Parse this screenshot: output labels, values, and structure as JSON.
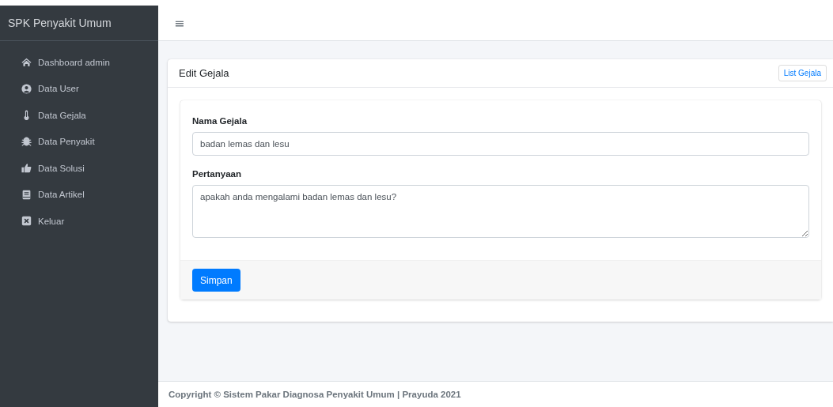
{
  "sidebar": {
    "brand": "SPK Penyakit Umum",
    "items": [
      {
        "label": "Dashboard admin"
      },
      {
        "label": "Data User"
      },
      {
        "label": "Data Gejala"
      },
      {
        "label": "Data Penyakit"
      },
      {
        "label": "Data Solusi"
      },
      {
        "label": "Data Artikel"
      },
      {
        "label": "Keluar"
      }
    ]
  },
  "navbar": {
    "menu_icon": "≡"
  },
  "card": {
    "title": "Edit Gejala",
    "header_button": "List Gejala",
    "form": {
      "fields": [
        {
          "kind": "input",
          "label": "Nama Gejala",
          "value": "badan lemas dan lesu"
        },
        {
          "kind": "textarea",
          "label": "Pertanyaan",
          "value": "apakah anda mengalami badan lemas dan lesu?"
        }
      ],
      "submit": "Simpan"
    }
  },
  "footer": {
    "text": "Copyright © Sistem Pakar Diagnosa Penyakit Umum | Prayuda 2021"
  }
}
